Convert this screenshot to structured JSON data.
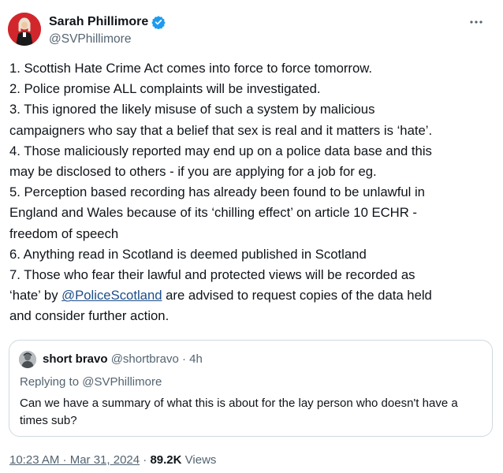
{
  "author": {
    "display_name": "Sarah Phillimore",
    "handle": "@SVPhillimore",
    "avatar_icon": "avatar-portrait-icon",
    "verified_icon": "verified-badge-icon",
    "verified_color": "#1d9bf0",
    "avatar_color": "#d2262d"
  },
  "tweet": {
    "lines": [
      "1. Scottish Hate Crime Act comes into force to force tomorrow.",
      "2. Police promise ALL complaints will be investigated.",
      "3. This ignored the likely misuse of such a system by malicious",
      "campaigners who say that a belief that sex is real and it matters is ‘hate’.",
      "4. Those maliciously reported may end up on a police data base and this",
      "may be disclosed to others - if you are applying for a job for eg.",
      "5. Perception based recording has already been found to be unlawful in",
      "England and Wales because of its ‘chilling effect’ on article 10 ECHR -",
      "freedom of speech",
      "6. Anything read in Scotland is deemed published in Scotland",
      "7. Those who fear their lawful and protected views will be recorded as"
    ],
    "line12_before": "‘hate’ by ",
    "mention": "@PoliceScotland",
    "line12_after": " are advised to request copies of the data held",
    "line13": "and consider further action."
  },
  "quote": {
    "name": "short bravo",
    "handle": "@shortbravo",
    "separator": "·",
    "time": "4h",
    "replying_to": "Replying to @SVPhillimore",
    "text": "Can we have a summary of what this is about for the lay person who doesn't have a times sub?"
  },
  "meta": {
    "time": "10:23 AM · Mar 31, 2024",
    "separator": "·",
    "views_count": "89.2K",
    "views_label": "Views"
  },
  "colors": {
    "link": "#1d4e89",
    "secondary_text": "#536471",
    "border": "#cfd9de"
  }
}
